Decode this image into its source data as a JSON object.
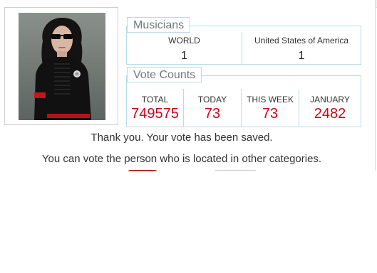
{
  "musicians": {
    "title": "Musicians",
    "items": [
      {
        "label": "WORLD",
        "value": "1"
      },
      {
        "label": "United States of America",
        "value": "1"
      }
    ]
  },
  "vote_counts": {
    "title": "Vote Counts",
    "items": [
      {
        "label": "TOTAL",
        "value": "749575"
      },
      {
        "label": "TODAY",
        "value": "73"
      },
      {
        "label": "THIS WEEK",
        "value": "73"
      },
      {
        "label": "JANUARY",
        "value": "2482"
      }
    ]
  },
  "messages": {
    "saved": "Thank you. Your vote has been saved.",
    "other": "You can vote the person who is located in other categories."
  },
  "colors": {
    "accent": "#d0021b",
    "panel_border": "#b9dbe8",
    "button_red": "#c9302c"
  }
}
